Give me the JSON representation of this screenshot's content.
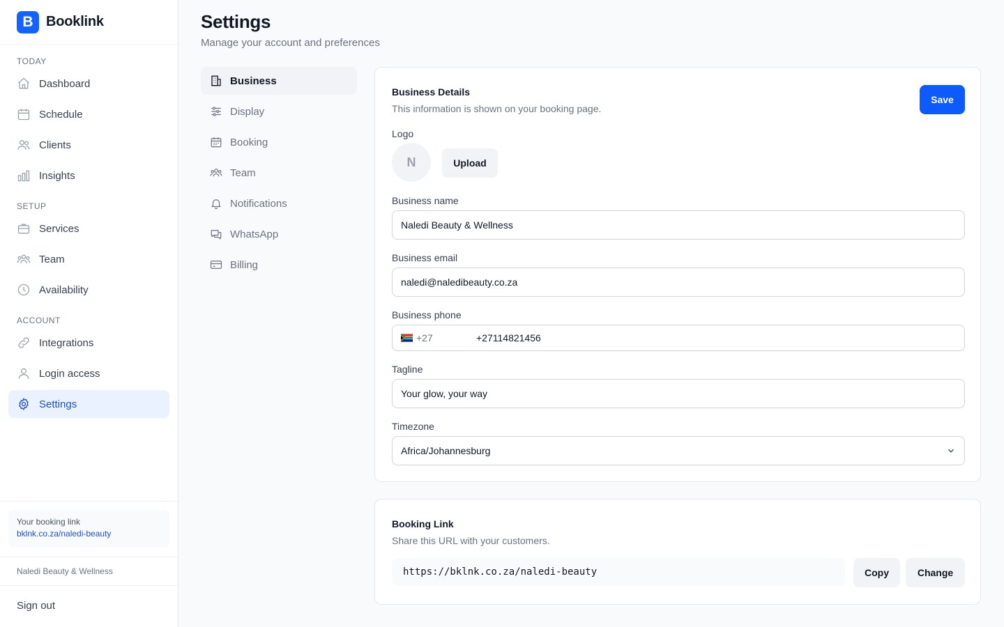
{
  "brand": {
    "logo_letter": "B",
    "name": "Booklink",
    "accent": "#1463ff"
  },
  "sidebar": {
    "sections": {
      "today": "TODAY",
      "setup": "SETUP",
      "account": "ACCOUNT"
    },
    "items": [
      {
        "label": "Dashboard",
        "icon": "home-icon"
      },
      {
        "label": "Schedule",
        "icon": "calendar-icon"
      },
      {
        "label": "Clients",
        "icon": "users-icon"
      },
      {
        "label": "Insights",
        "icon": "bar-chart-icon"
      },
      {
        "label": "Services",
        "icon": "briefcase-icon"
      },
      {
        "label": "Team",
        "icon": "team-icon"
      },
      {
        "label": "Availability",
        "icon": "clock-icon"
      },
      {
        "label": "Integrations",
        "icon": "link-icon"
      },
      {
        "label": "Login access",
        "icon": "user-icon"
      },
      {
        "label": "Settings",
        "icon": "gear-icon",
        "active": true
      }
    ],
    "booking_link_label": "Your booking link",
    "booking_link_url": "bklnk.co.za/naledi-beauty",
    "business_name": "Naledi Beauty & Wellness",
    "sign_out": "Sign out"
  },
  "header": {
    "title": "Settings",
    "subtitle": "Manage your account and preferences"
  },
  "settings_nav": [
    {
      "label": "Business",
      "icon": "building-icon",
      "active": true
    },
    {
      "label": "Display",
      "icon": "sliders-icon"
    },
    {
      "label": "Booking",
      "icon": "calendar-icon"
    },
    {
      "label": "Team",
      "icon": "team-icon"
    },
    {
      "label": "Notifications",
      "icon": "bell-icon"
    },
    {
      "label": "WhatsApp",
      "icon": "chat-icon"
    },
    {
      "label": "Billing",
      "icon": "credit-card-icon"
    }
  ],
  "business_details": {
    "title": "Business Details",
    "description": "This information is shown on your booking page.",
    "save_label": "Save",
    "logo_label": "Logo",
    "logo_initial": "N",
    "upload_label": "Upload",
    "name_label": "Business name",
    "name_value": "Naledi Beauty & Wellness",
    "email_label": "Business email",
    "email_value": "naledi@naledibeauty.co.za",
    "phone_label": "Business phone",
    "phone_prefix": "+27",
    "phone_value": "+27114821456",
    "tagline_label": "Tagline",
    "tagline_value": "Your glow, your way",
    "timezone_label": "Timezone",
    "timezone_value": "Africa/Johannesburg"
  },
  "booking_link": {
    "title": "Booking Link",
    "description": "Share this URL with your customers.",
    "url": "https://bklnk.co.za/naledi-beauty",
    "copy_label": "Copy",
    "change_label": "Change"
  }
}
